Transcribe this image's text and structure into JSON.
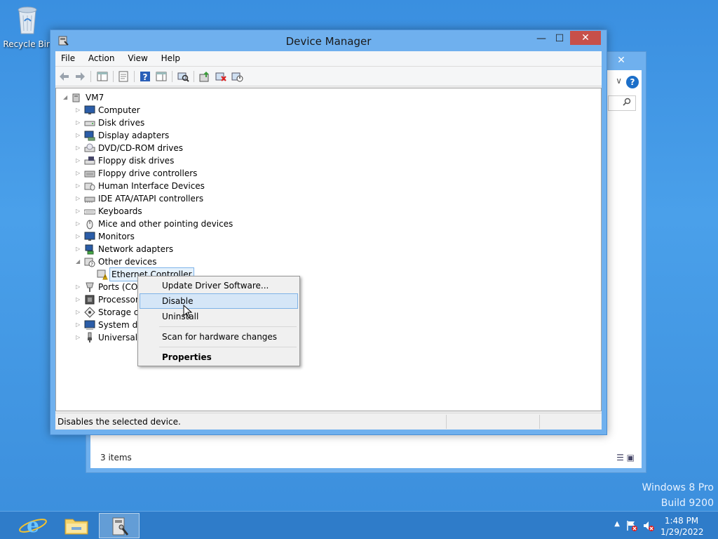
{
  "desktop": {
    "recycle_bin_label": "Recycle Bin",
    "watermark_line1": "Windows 8 Pro",
    "watermark_line2": "Build 9200"
  },
  "background_window": {
    "close_glyph": "✕",
    "help_glyph": "?",
    "status_text": "3 items"
  },
  "window": {
    "title": "Device Manager",
    "min_glyph": "—",
    "max_glyph": "☐",
    "close_glyph": "✕"
  },
  "menu": {
    "items": [
      "File",
      "Action",
      "View",
      "Help"
    ]
  },
  "toolbar": {
    "buttons": [
      "back-icon",
      "forward-icon",
      "show-hide-tree-icon",
      "properties-icon",
      "help-icon",
      "action-pane-icon",
      "scan-hardware-icon",
      "update-driver-icon",
      "uninstall-icon",
      "disable-icon"
    ]
  },
  "tree": {
    "root": "VM7",
    "categories": [
      "Computer",
      "Disk drives",
      "Display adapters",
      "DVD/CD-ROM drives",
      "Floppy disk drives",
      "Floppy drive controllers",
      "Human Interface Devices",
      "IDE ATA/ATAPI controllers",
      "Keyboards",
      "Mice and other pointing devices",
      "Monitors",
      "Network adapters",
      "Other devices",
      "Ethernet Controller",
      "Ports (COM",
      "Processors",
      "Storage co",
      "System de",
      "Universal S"
    ]
  },
  "context_menu": {
    "items": [
      {
        "label": "Update Driver Software...",
        "highlighted": false,
        "bold": false
      },
      {
        "label": "Disable",
        "highlighted": true,
        "bold": false
      },
      {
        "label": "Uninstall",
        "highlighted": false,
        "bold": false
      },
      {
        "label": "Scan for hardware changes",
        "highlighted": false,
        "bold": false
      },
      {
        "label": "Properties",
        "highlighted": false,
        "bold": true
      }
    ]
  },
  "statusbar": {
    "message": "Disables the selected device."
  },
  "taskbar": {
    "time": "1:48 PM",
    "date": "1/29/2022",
    "tray_arrow": "▲"
  },
  "colors": {
    "accent": "#6fb0ee",
    "close_red": "#c7504a",
    "taskbar": "#2f7cc9",
    "highlight": "#d5e6f7"
  }
}
